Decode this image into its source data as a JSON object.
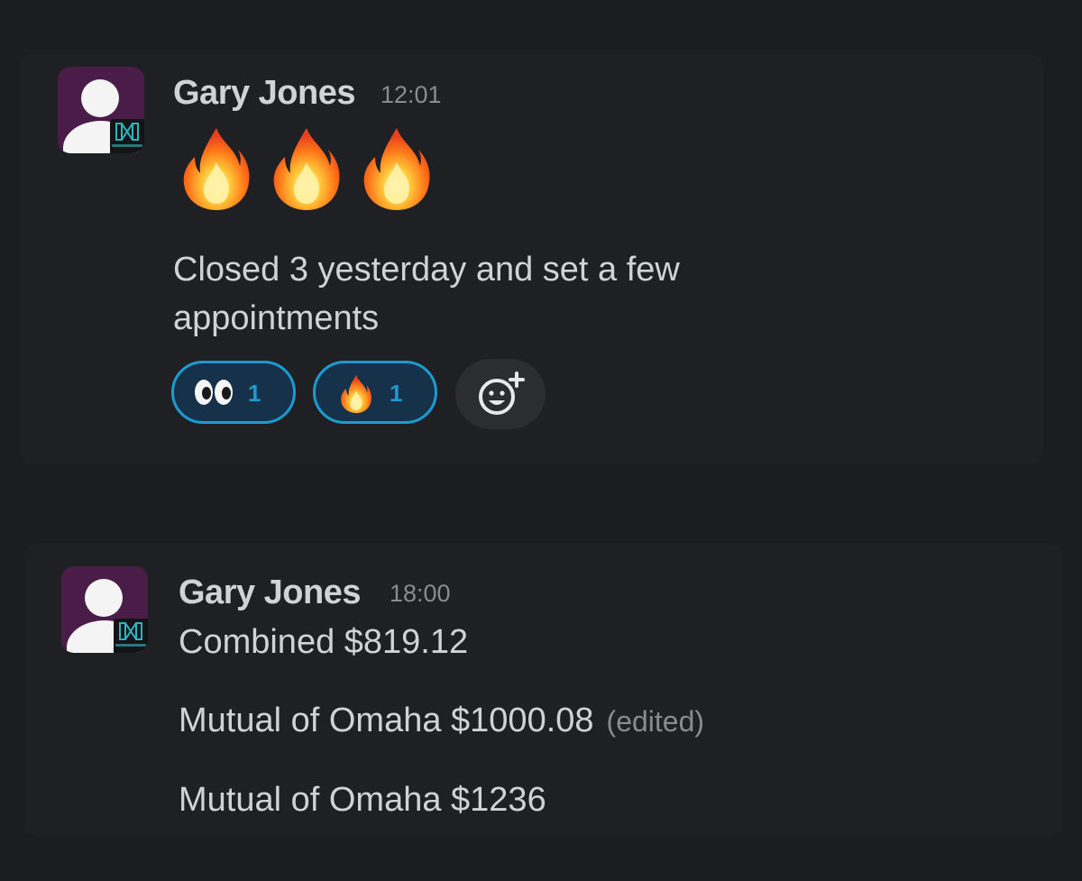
{
  "messages": [
    {
      "author": "Gary Jones",
      "time": "12:01",
      "emoji_line": [
        "fire",
        "fire",
        "fire"
      ],
      "text_line1": "Closed 3 yesterday and set a few",
      "text_line2": "appointments",
      "reactions": [
        {
          "emoji": "eyes",
          "count": "1"
        },
        {
          "emoji": "fire",
          "count": "1"
        }
      ]
    },
    {
      "author": "Gary Jones",
      "time": "18:00",
      "line1": "Combined $819.12",
      "line2": "Mutual of Omaha $1000.08",
      "edited": "(edited)",
      "line3": "Mutual of Omaha $1236"
    }
  ],
  "colors": {
    "background": "#1b1d21",
    "text": "#d1d2d3",
    "muted": "#8a8b8e",
    "reaction_accent": "#1d9bd1",
    "avatar_bg": "#4a1d48"
  }
}
